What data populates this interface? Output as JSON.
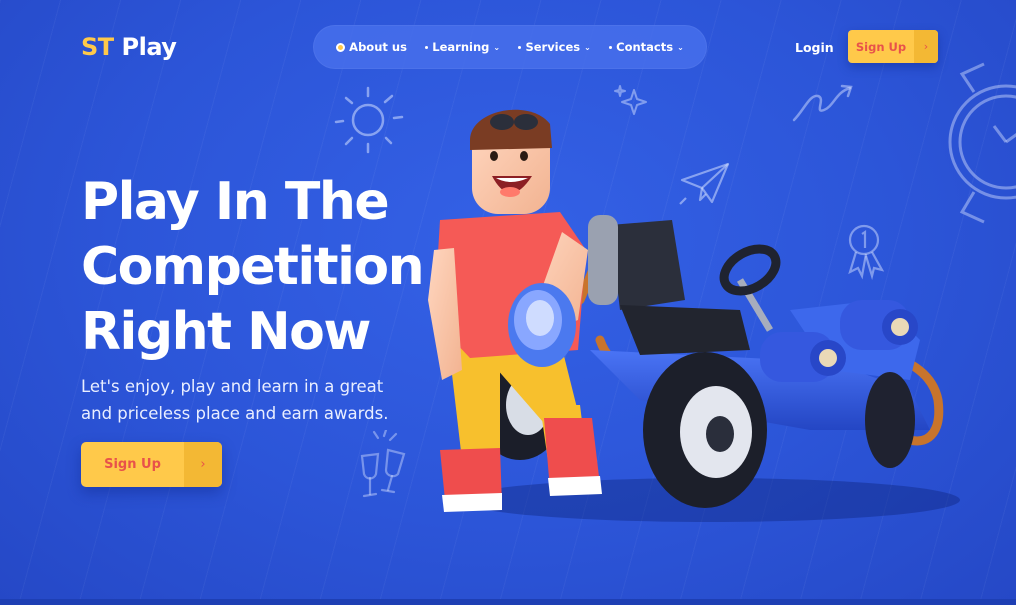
{
  "header": {
    "logo_primary": "ST",
    "logo_secondary": "Play",
    "nav": [
      {
        "label": "About us",
        "has_dropdown": false
      },
      {
        "label": "Learning",
        "has_dropdown": true
      },
      {
        "label": "Services",
        "has_dropdown": true
      },
      {
        "label": "Contacts",
        "has_dropdown": true
      }
    ],
    "login_label": "Login",
    "signup_label": "Sign Up",
    "signup_arrow": "›"
  },
  "hero": {
    "title_lines": [
      "Play In The",
      "Competition",
      "Right Now"
    ],
    "subtitle_lines": [
      "Let's enjoy, play and learn in a great",
      "and priceless place and earn awards."
    ],
    "cta_label": "Sign Up",
    "cta_arrow": "›"
  },
  "icons": [
    "sun-doodle-icon",
    "sparkle-doodle-icon",
    "arrow-loop-doodle-icon",
    "paper-plane-doodle-icon",
    "clock-doodle-icon",
    "medal-doodle-icon",
    "cheers-doodle-icon",
    "chevron-down-icon"
  ],
  "colors": {
    "background": "#2c55d8",
    "accent": "#ffc94a",
    "accent_text": "#e8524a",
    "nav_pill": "#466eeb"
  }
}
